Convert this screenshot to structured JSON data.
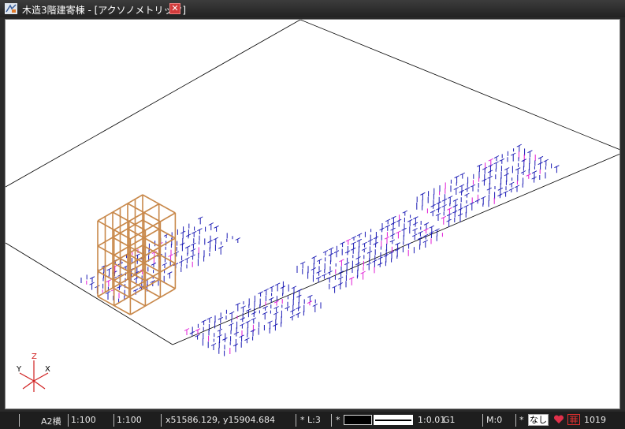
{
  "window": {
    "title": "木造3階建寄棟 - [アクソノメトリック]",
    "close_glyph": "✕"
  },
  "axes": {
    "x": "X",
    "y": "Y",
    "z": "Z"
  },
  "status": {
    "paper": "A2横",
    "scale1": "1:100",
    "scale2": "1:100",
    "coords": "x51586.129, y15904.684",
    "layer_prefix": "*",
    "layer": "L:3",
    "color_prefix": "*",
    "line_scale": "1:0.01",
    "group": "G1",
    "mode": "M:0",
    "snap_prefix": "*",
    "snap": "なし",
    "count": "1019"
  },
  "colors": {
    "frame": "#c8884a",
    "plan_lines": "#1a1ab4",
    "highlight": "#e01ad6",
    "ground": "#000000",
    "status_heart": "#e0304a",
    "status_calc": "#e03030"
  },
  "icons": [
    "app-icon",
    "close-icon",
    "axis-gizmo-icon",
    "heart-icon",
    "calculator-icon"
  ]
}
